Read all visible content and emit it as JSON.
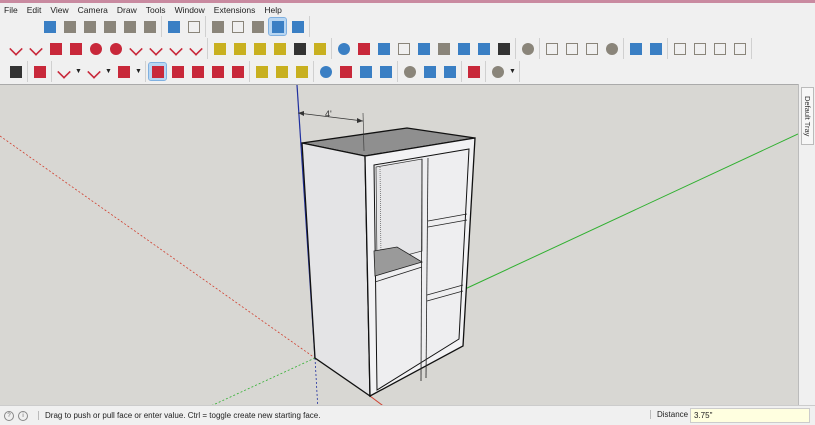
{
  "menu": [
    "File",
    "Edit",
    "View",
    "Camera",
    "Draw",
    "Tools",
    "Window",
    "Extensions",
    "Help"
  ],
  "toolbars": {
    "row1": [
      [
        "iso-view-icon",
        "front-view-icon",
        "top-view-icon",
        "right-view-icon",
        "back-view-icon",
        "left-view-icon"
      ],
      [
        "xray-icon",
        "back-edges-icon"
      ],
      [
        "wireframe-icon",
        "hidden-line-icon",
        "shaded-icon",
        "shaded-textures-icon",
        "monochrome-icon"
      ]
    ],
    "row2": [
      [
        "pencil-icon",
        "freehand-icon",
        "rectangle-icon",
        "rotated-rectangle-icon",
        "circle-icon",
        "polygon-icon",
        "arc-icon",
        "two-point-arc-icon",
        "three-point-arc-icon",
        "pie-icon"
      ],
      [
        "tape-measure-icon",
        "dimension-icon",
        "protractor-icon",
        "text-icon",
        "axes-icon",
        "3d-text-icon"
      ],
      [
        "orbit-icon",
        "pan-icon",
        "zoom-icon",
        "zoom-window-icon",
        "zoom-extents-icon",
        "previous-view-icon",
        "position-camera-icon",
        "look-around-icon",
        "walk-icon"
      ],
      [
        "model-info-icon"
      ],
      [
        "warehouse-icon",
        "share-model-icon",
        "cloud-icon",
        "sync-icon"
      ],
      [
        "section-plane-icon",
        "section-fill-icon"
      ],
      [
        "window-icon",
        "component-icon",
        "materials-icon",
        "lock-icon"
      ]
    ],
    "row3": [
      [
        "select-icon"
      ],
      [
        "eraser-icon"
      ],
      [
        "pencil-dropdown-icon",
        "arc-dropdown-icon",
        "shape-dropdown-icon"
      ],
      [
        "push-pull-icon",
        "follow-me-icon",
        "move-icon",
        "rotate-icon",
        "scale-icon"
      ],
      [
        "tape-measure-icon",
        "text-icon",
        "paint-bucket-icon"
      ],
      [
        "orbit-icon",
        "pan-icon",
        "zoom-icon",
        "zoom-extents-icon"
      ],
      [
        "outer-shell-icon",
        "intersect-icon",
        "union-icon"
      ],
      [
        "solid-tools-icon"
      ],
      [
        "account-icon"
      ]
    ]
  },
  "active_tools": [
    "shaded-textures-icon",
    "push-pull-icon"
  ],
  "dropdown_tools": [
    "pencil-dropdown-icon",
    "arc-dropdown-icon",
    "shape-dropdown-icon",
    "account-icon"
  ],
  "icon_colors": {
    "red": "#c8283a",
    "blue": "#3a7fc4",
    "gray": "#8a857a",
    "dark": "#333333",
    "yellow": "#c8b020"
  },
  "dimension": {
    "label": "4'"
  },
  "tray": {
    "title": "Default Tray"
  },
  "status": {
    "message": "Drag to push or pull face or enter value.  Ctrl = toggle create new starting face.",
    "measure_label": "Distance",
    "measure_value": "3.75\""
  },
  "axes_colors": {
    "red": "#d04030",
    "green": "#30b030",
    "blue": "#2030a0"
  }
}
